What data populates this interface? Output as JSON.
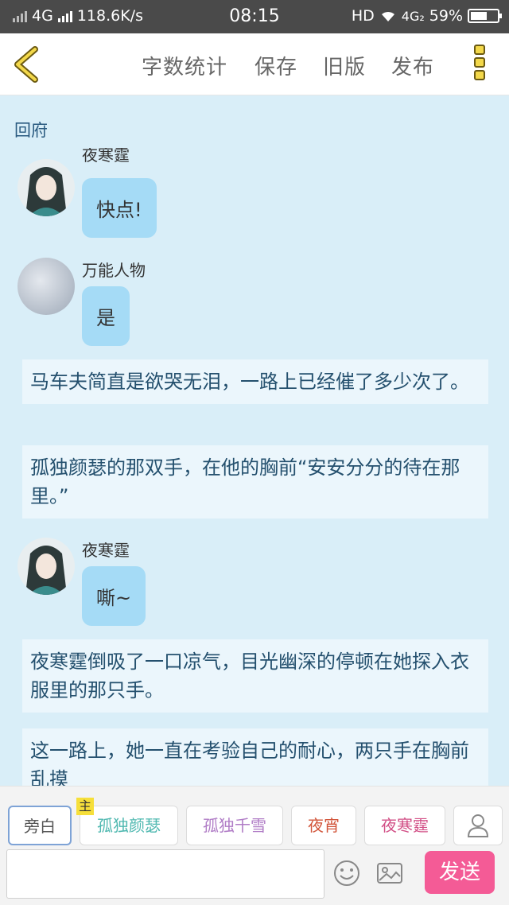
{
  "status_bar": {
    "network": "4G",
    "speed": "118.6K/s",
    "time": "08:15",
    "hd": "HD",
    "network2": "4G₂",
    "battery": "59%"
  },
  "toolbar": {
    "word_count": "字数统计",
    "save": "保存",
    "old_version": "旧版",
    "publish": "发布"
  },
  "chat": {
    "title": "回府",
    "messages": [
      {
        "speaker": "夜寒霆",
        "text": "快点!"
      },
      {
        "speaker": "万能人物",
        "text": "是"
      },
      {
        "narration": "马车夫简直是欲哭无泪，一路上已经催了多少次了。"
      },
      {
        "narration": "孤独颜瑟的那双手，在他的胸前“安安分分的待在那里。”"
      },
      {
        "speaker": "夜寒霆",
        "text": "嘶~"
      },
      {
        "narration": "夜寒霆倒吸了一口凉气，目光幽深的停顿在她探入衣服里的那只手。"
      },
      {
        "narration": "这一路上，她一直在考验自己的耐心，两只手在胸前乱摸"
      }
    ]
  },
  "characters": {
    "host_tag": "主",
    "items": [
      {
        "label": "旁白",
        "color": "#666666"
      },
      {
        "label": "孤独颜瑟",
        "color": "#4fb8b0"
      },
      {
        "label": "孤独千雪",
        "color": "#b07cc6"
      },
      {
        "label": "夜宵",
        "color": "#d2553a"
      },
      {
        "label": "夜寒霆",
        "color": "#d24f86"
      }
    ]
  },
  "input": {
    "value": "",
    "placeholder": "",
    "send_label": "发送"
  },
  "colors": {
    "accent": "#f45b96",
    "chat_bg": "#d9eef8",
    "bubble": "#a5dbf6"
  }
}
